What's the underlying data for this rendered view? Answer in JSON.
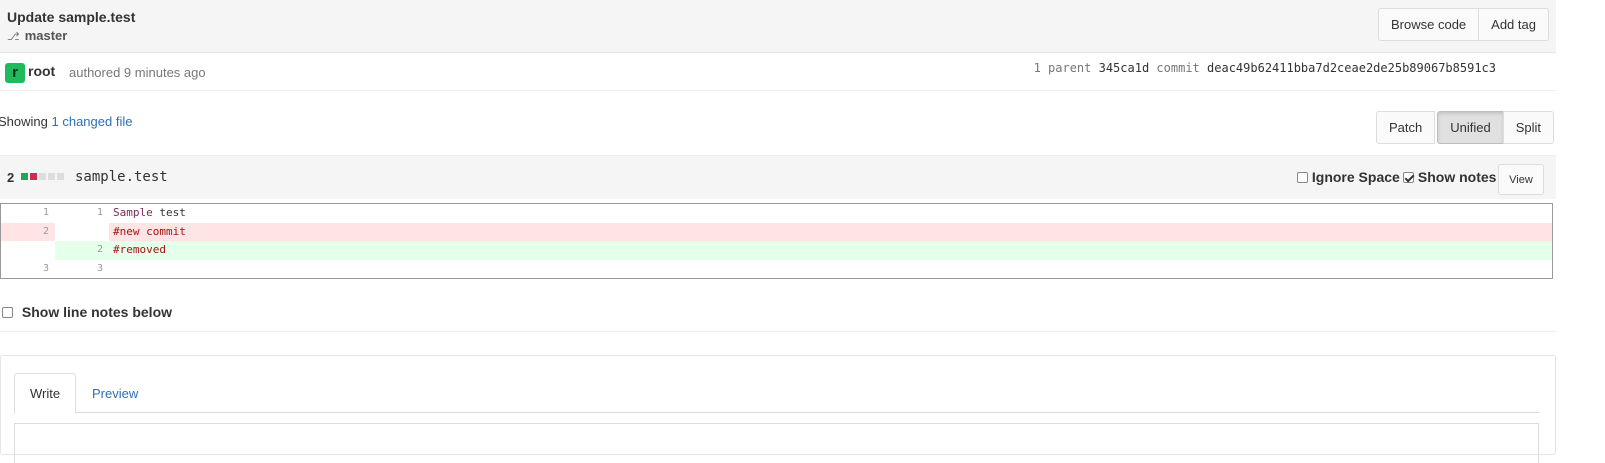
{
  "commit": {
    "title": "Update sample.test",
    "branch": "master",
    "buttons": {
      "browse_code": "Browse code",
      "add_tag": "Add tag"
    },
    "author": {
      "avatar_letter": "r",
      "name": "root",
      "authored_text": "authored 9 minutes ago"
    },
    "meta": {
      "parent_label": "1 parent",
      "parent_sha": "345ca1d",
      "commit_label": "commit",
      "commit_sha": "deac49b62411bba7d2ceae2de25b89067b8591c3"
    }
  },
  "summary": {
    "prefix": "Showing",
    "link": "1 changed file"
  },
  "view_modes": {
    "patch": "Patch",
    "unified": "Unified",
    "split": "Split",
    "active": "Unified"
  },
  "file": {
    "count": "2",
    "name": "sample.test",
    "ignore_space": "Ignore Space",
    "show_notes": "Show notes",
    "view_button": "View",
    "stat_colors": [
      "#1aaa55",
      "#d22852",
      "#dddddd",
      "#dddddd",
      "#dddddd"
    ]
  },
  "diff": {
    "lines": [
      {
        "old": "1",
        "new": "1",
        "type": "context",
        "text_a": "Sample",
        "text_b": " test"
      },
      {
        "old": "2",
        "new": "",
        "type": "old",
        "text_a": "#new commit",
        "text_b": ""
      },
      {
        "old": "",
        "new": "2",
        "type": "new",
        "text_a": "#removed",
        "text_b": ""
      },
      {
        "old": "3",
        "new": "3",
        "type": "context",
        "text_a": "",
        "text_b": ""
      }
    ]
  },
  "line_notes": {
    "label": "Show line notes below"
  },
  "comment_form": {
    "tab_write": "Write",
    "tab_preview": "Preview"
  }
}
